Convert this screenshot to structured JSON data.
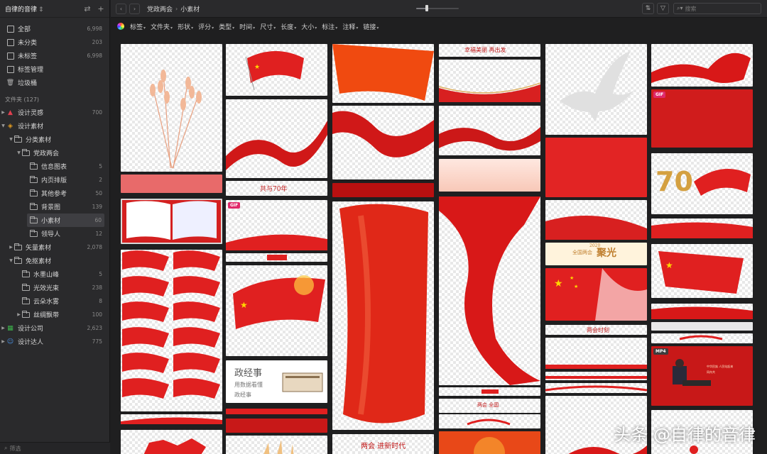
{
  "library": {
    "title": "自律的音律"
  },
  "sidebar": {
    "quick": [
      {
        "label": "全部",
        "count": "6,998",
        "icon": "all-items-icon"
      },
      {
        "label": "未分类",
        "count": "203",
        "icon": "uncategorized-icon"
      },
      {
        "label": "未标签",
        "count": "6,998",
        "icon": "untagged-icon"
      },
      {
        "label": "标签管理",
        "count": "",
        "icon": "tag-manage-icon"
      },
      {
        "label": "垃圾桶",
        "count": "",
        "icon": "trash-icon"
      }
    ],
    "folders_header": "文件夹 (127)",
    "folders": [
      {
        "label": "设计灵感",
        "count": "700"
      },
      {
        "label": "设计素材",
        "count": ""
      },
      {
        "label": "分类素材",
        "count": ""
      },
      {
        "label": "党政两会",
        "count": ""
      },
      {
        "label": "信息图表",
        "count": "5"
      },
      {
        "label": "内页排版",
        "count": "2"
      },
      {
        "label": "其他参考",
        "count": "50"
      },
      {
        "label": "背景图",
        "count": "139"
      },
      {
        "label": "小素材",
        "count": "60"
      },
      {
        "label": "领导人",
        "count": "12"
      },
      {
        "label": "矢量素材",
        "count": "2,078"
      },
      {
        "label": "免抠素材",
        "count": ""
      },
      {
        "label": "水墨山峰",
        "count": "5"
      },
      {
        "label": "光效光束",
        "count": "238"
      },
      {
        "label": "云朵水雾",
        "count": "8"
      },
      {
        "label": "丝绸飘带",
        "count": "100"
      },
      {
        "label": "设计公司",
        "count": "2,623"
      },
      {
        "label": "设计达人",
        "count": "775"
      }
    ],
    "filter_placeholder": "筛选"
  },
  "topbar": {
    "breadcrumb": [
      "党政两会",
      "小素材"
    ],
    "search_placeholder": "搜索",
    "zoom_fraction": 0.25
  },
  "filters": [
    "标签",
    "文件夹",
    "形状",
    "评分",
    "类型",
    "时间",
    "尺寸",
    "长度",
    "大小",
    "标注",
    "注释",
    "链接"
  ],
  "gallery": {
    "badges": {
      "gif": "GIF",
      "mp4": "MP4"
    },
    "texts": {
      "slogan_70": "共与70年",
      "promo_top": "幸福美丽 再出发",
      "promo_small": "两会 全国",
      "liangh_year": "2020",
      "liangh_title": "全国两会",
      "liangh_big": "聚光",
      "hot_text": "两会时刻",
      "zhengjing_title": "政经事",
      "zhengjing_sub": "用数据看懂",
      "zhengjing_sub2": "政经事",
      "seventy": "70",
      "video_title": "中华民族 人民站起来",
      "video_sub": "同舟共",
      "bottom_title": "两会 进新时代"
    },
    "watermark": "头条 @自律的音律"
  },
  "colors": {
    "accent_red": "#e02020",
    "gif_badge": "#e0296a",
    "selected_outline": "#d8d8d8"
  }
}
